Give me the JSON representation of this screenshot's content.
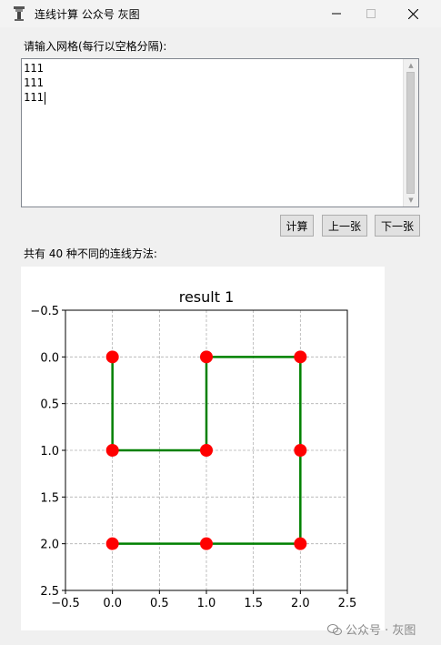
{
  "window": {
    "title": "连线计算 公众号 灰图",
    "controls": {
      "minimize": "—",
      "maximize": "☐",
      "close": "✕"
    }
  },
  "input": {
    "label": "请输入网格(每行以空格分隔):",
    "lines": [
      "111",
      "111",
      "111"
    ]
  },
  "buttons": {
    "calc": "计算",
    "prev": "上一张",
    "next": "下一张"
  },
  "summary": "共有 40 种不同的连线方法:",
  "chart_data": {
    "type": "line",
    "title": "result 1",
    "xlim": [
      -0.5,
      2.5
    ],
    "ylim": [
      2.5,
      -0.5
    ],
    "y_inverted": true,
    "xticks": [
      "−0.5",
      "0.0",
      "0.5",
      "1.0",
      "1.5",
      "2.0",
      "2.5"
    ],
    "yticks": [
      "−0.5",
      "0.0",
      "0.5",
      "1.0",
      "1.5",
      "2.0",
      "2.5"
    ],
    "xtick_values": [
      -0.5,
      0,
      0.5,
      1,
      1.5,
      2,
      2.5
    ],
    "ytick_values": [
      -0.5,
      0,
      0.5,
      1,
      1.5,
      2,
      2.5
    ],
    "grid": true,
    "line_color": "#008000",
    "point_color": "#ff0000",
    "path": [
      [
        0,
        0
      ],
      [
        0,
        1
      ],
      [
        1,
        1
      ],
      [
        1,
        0
      ],
      [
        2,
        0
      ],
      [
        2,
        1
      ],
      [
        2,
        2
      ],
      [
        1,
        2
      ],
      [
        0,
        2
      ]
    ],
    "points": [
      [
        0,
        0
      ],
      [
        1,
        0
      ],
      [
        2,
        0
      ],
      [
        0,
        1
      ],
      [
        1,
        1
      ],
      [
        2,
        1
      ],
      [
        0,
        2
      ],
      [
        1,
        2
      ],
      [
        2,
        2
      ]
    ]
  },
  "watermark": "公众号 · 灰图"
}
